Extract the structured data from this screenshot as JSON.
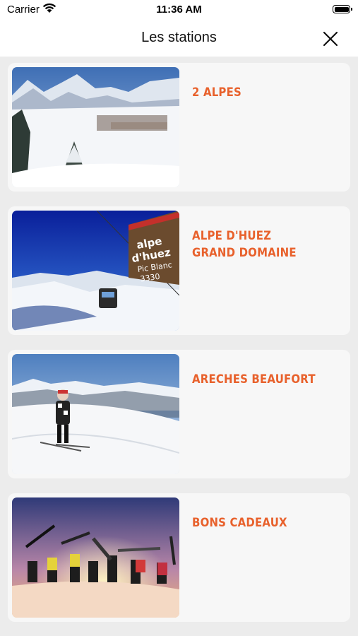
{
  "status_bar": {
    "carrier": "Carrier",
    "time": "11:36 AM",
    "wifi_icon": "wifi-icon",
    "battery_icon": "battery-icon"
  },
  "nav": {
    "title": "Les stations",
    "close_icon": "close-icon"
  },
  "accent_color": "#e8612c",
  "stations": [
    {
      "name": "2 ALPES",
      "image": "mountain-village-photo"
    },
    {
      "name": "ALPE D'HUEZ\nGRAND DOMAINE",
      "image": "cable-car-sign-photo",
      "sign_text": [
        "alpe",
        "d'huez",
        "Pic Blanc",
        "3330"
      ]
    },
    {
      "name": "ARECHES BEAUFORT",
      "image": "skier-slope-photo"
    },
    {
      "name": "BONS CADEAUX",
      "image": "group-sunset-photo"
    }
  ]
}
